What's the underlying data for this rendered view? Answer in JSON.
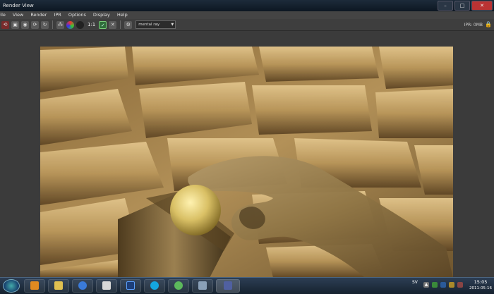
{
  "window": {
    "title": "Render View",
    "controls": {
      "minimize": "–",
      "maximize": "□",
      "close": "✕"
    }
  },
  "menu": [
    "File",
    "View",
    "Render",
    "IPR",
    "Options",
    "Display",
    "Help"
  ],
  "toolbar": {
    "ratio_label": "1:1",
    "renderer_value": "mental ray",
    "ipr_readout": "IPR: 0MB"
  },
  "taskbar": {
    "language": "SV",
    "clock_time": "15:05",
    "clock_date": "2011-05-16",
    "apps": [
      {
        "name": "media-player",
        "icon": "media-player-icon",
        "color": "#e08a20"
      },
      {
        "name": "explorer",
        "icon": "folder-icon",
        "color": "#e0c050"
      },
      {
        "name": "internet-explorer",
        "icon": "internet-explorer-icon",
        "color": "#3a7ad8"
      },
      {
        "name": "document",
        "icon": "document-icon",
        "color": "#d8d8d8"
      },
      {
        "name": "photoshop",
        "icon": "photoshop-icon",
        "color": "#1d3f7a"
      },
      {
        "name": "skype",
        "icon": "skype-icon",
        "color": "#14a6e0"
      },
      {
        "name": "messenger",
        "icon": "messenger-icon",
        "color": "#5cb85c"
      },
      {
        "name": "settings",
        "icon": "tools-icon",
        "color": "#8aa0b8"
      },
      {
        "name": "maya",
        "icon": "maya-icon",
        "color": "#5060a0"
      }
    ]
  },
  "colors": {
    "accent": "#1d2b3a",
    "panel": "#3c3c3c",
    "render_gold": "#b8934f"
  }
}
